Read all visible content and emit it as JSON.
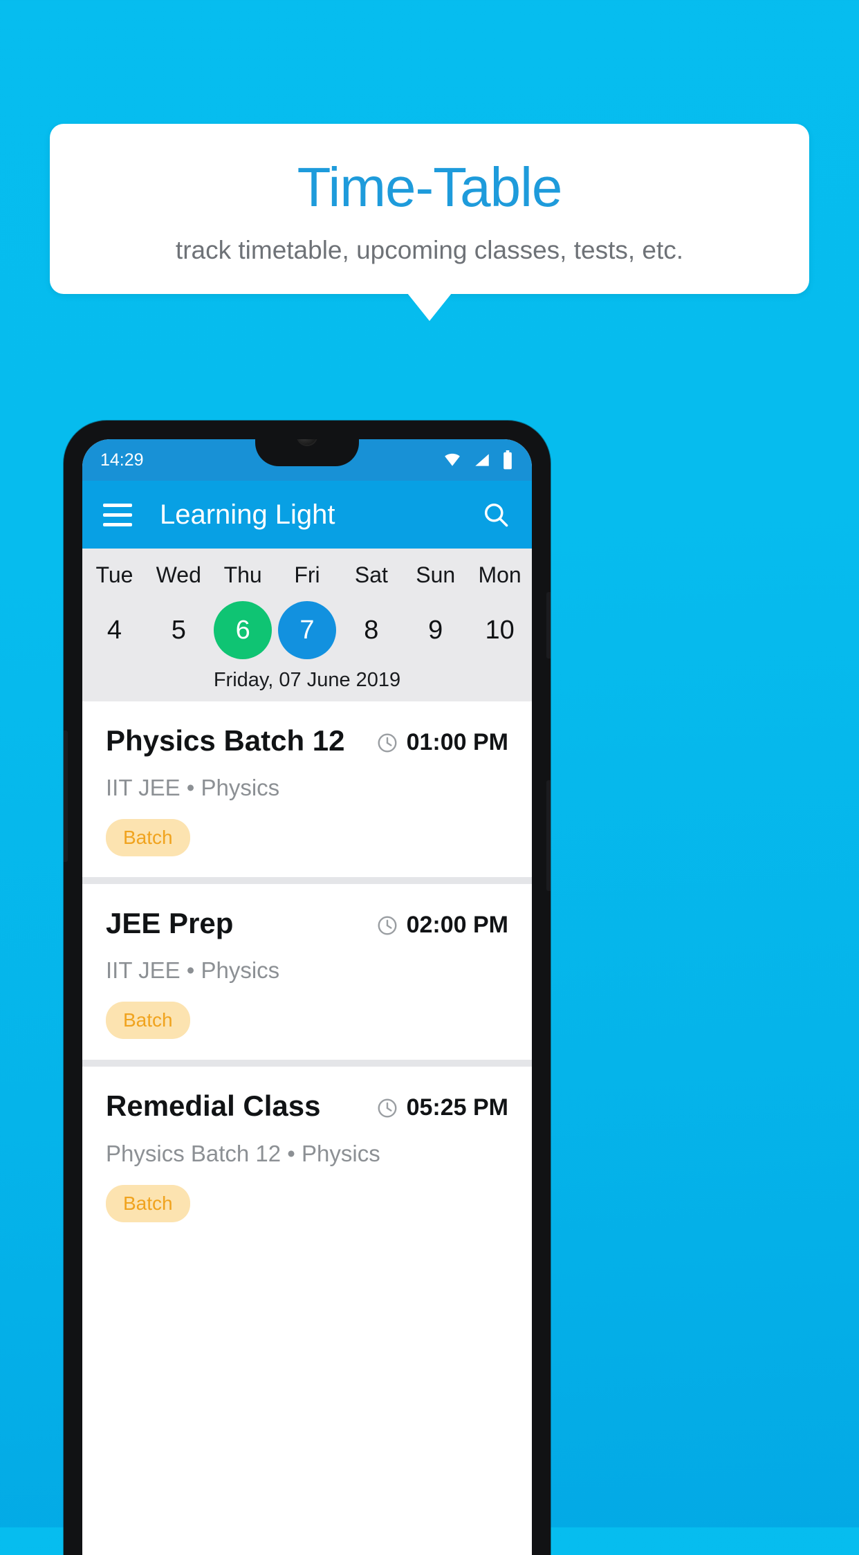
{
  "promo": {
    "title": "Time-Table",
    "subtitle": "track timetable, upcoming classes, tests, etc.",
    "title_color": "#1E9BDB",
    "background_color": "#06BDEF"
  },
  "phone": {
    "status_bar": {
      "time": "14:29",
      "icons": [
        "wifi-icon",
        "signal-icon",
        "battery-icon"
      ]
    },
    "app_bar": {
      "menu_icon": "hamburger-menu-icon",
      "title": "Learning Light",
      "search_icon": "search-icon",
      "background_color": "#08A0E4"
    },
    "week_strip": {
      "days": [
        {
          "name": "Tue",
          "number": "4",
          "state": "normal"
        },
        {
          "name": "Wed",
          "number": "5",
          "state": "normal"
        },
        {
          "name": "Thu",
          "number": "6",
          "state": "today"
        },
        {
          "name": "Fri",
          "number": "7",
          "state": "selected"
        },
        {
          "name": "Sat",
          "number": "8",
          "state": "normal"
        },
        {
          "name": "Sun",
          "number": "9",
          "state": "normal"
        },
        {
          "name": "Mon",
          "number": "10",
          "state": "normal"
        }
      ],
      "today_color": "#0FC473",
      "selected_color": "#1291DF",
      "date_label": "Friday, 07 June 2019"
    },
    "classes": [
      {
        "title": "Physics Batch 12",
        "time": "01:00 PM",
        "subtitle": "IIT JEE • Physics",
        "badge": "Batch"
      },
      {
        "title": "JEE Prep",
        "time": "02:00 PM",
        "subtitle": "IIT JEE • Physics",
        "badge": "Batch"
      },
      {
        "title": "Remedial Class",
        "time": "05:25 PM",
        "subtitle": "Physics Batch 12 • Physics",
        "badge": "Batch"
      }
    ],
    "badge_bg_color": "#FCE3B0",
    "badge_text_color": "#F0A31E"
  }
}
